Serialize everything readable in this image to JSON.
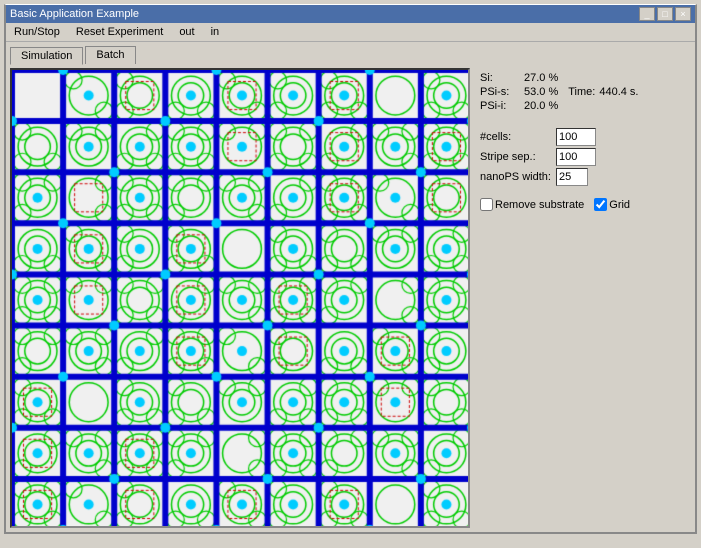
{
  "window": {
    "title": "Basic Application Example",
    "controls": [
      "_",
      "□",
      "×"
    ]
  },
  "menubar": {
    "items": [
      "Run/Stop",
      "Reset Experiment",
      "out",
      "in"
    ]
  },
  "tabs": [
    {
      "label": "Simulation",
      "active": true
    },
    {
      "label": "Batch",
      "active": false
    }
  ],
  "stats": {
    "si_label": "Si:",
    "si_value": "27.0 %",
    "psi_s_label": "PSi-s:",
    "psi_s_value": "53.0 %",
    "time_label": "Time:",
    "time_value": "440.4 s.",
    "psi_i_label": "PSi-i:",
    "psi_i_value": "20.0 %"
  },
  "controls": {
    "cells_label": "#cells:",
    "cells_value": "100",
    "stripe_sep_label": "Stripe sep.:",
    "stripe_sep_value": "100",
    "nano_ps_label": "nanoPS width:",
    "nano_ps_value": "25"
  },
  "checkboxes": {
    "remove_substrate_label": "Remove substrate",
    "remove_substrate_checked": false,
    "grid_label": "Grid",
    "grid_checked": true
  },
  "grid": {
    "cols": 9,
    "rows": 9,
    "cell_size": 50,
    "blue_line_width": 6
  }
}
